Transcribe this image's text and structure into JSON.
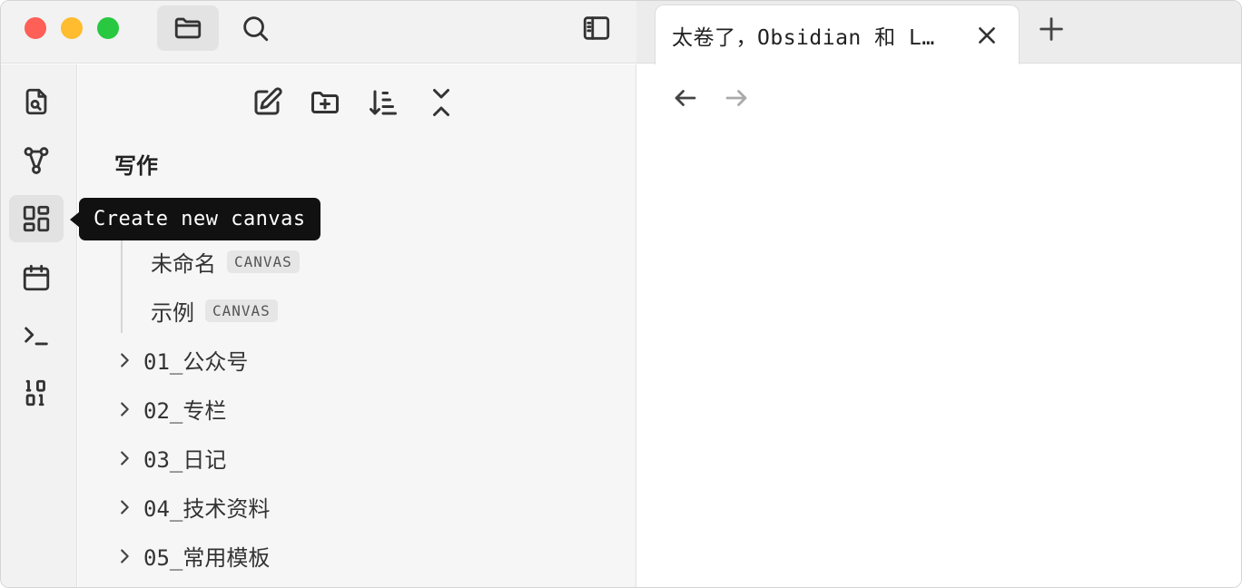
{
  "tab": {
    "title": "太卷了，Obsidian 和 L…"
  },
  "ribbon": {
    "items": [
      {
        "icon": "file-search-icon"
      },
      {
        "icon": "graph-icon"
      },
      {
        "icon": "canvas-icon",
        "active": true
      },
      {
        "icon": "calendar-icon"
      },
      {
        "icon": "terminal-icon"
      },
      {
        "icon": "binary-icon"
      }
    ]
  },
  "tooltip": {
    "text": "Create new canvas"
  },
  "explorer": {
    "vault_name": "写作",
    "files": [
      {
        "name": "未命名",
        "badge": "CANVAS"
      },
      {
        "name": "示例",
        "badge": "CANVAS"
      }
    ],
    "folders": [
      {
        "name": "01_公众号"
      },
      {
        "name": "02_专栏"
      },
      {
        "name": "03_日记"
      },
      {
        "name": "04_技术资料"
      },
      {
        "name": "05_常用模板"
      }
    ]
  },
  "colors": {
    "traffic_red": "#fe5f57",
    "traffic_yellow": "#febc2e",
    "traffic_green": "#28c840",
    "tooltip_bg": "#111111"
  }
}
